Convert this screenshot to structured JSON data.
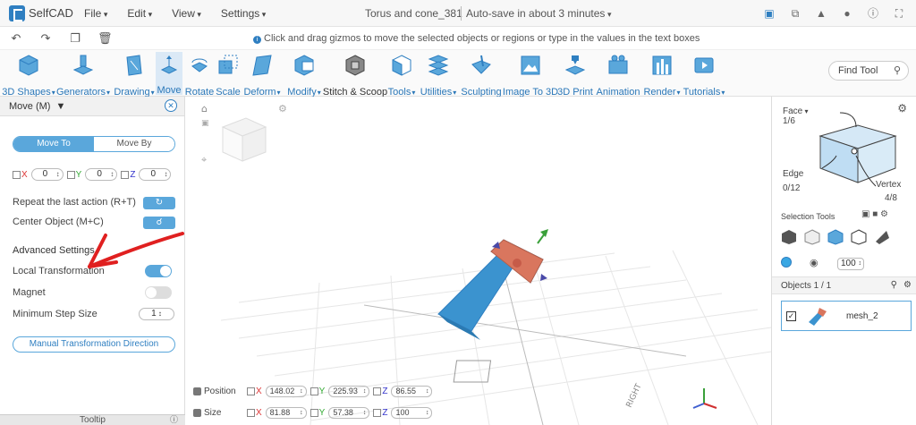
{
  "app": {
    "name": "SelfCAD",
    "menus": [
      "File",
      "Edit",
      "View",
      "Settings"
    ],
    "project_title": "Torus and cone_381",
    "autosave": "Auto-save in about 3 minutes"
  },
  "hint": "Click and drag gizmos to move the selected objects or regions or type in the values in the text boxes",
  "toolbar": {
    "tools": [
      {
        "label": "3D Shapes",
        "icon": "cube-icon",
        "dropdown": true
      },
      {
        "label": "Generators",
        "icon": "generator-icon",
        "dropdown": true
      },
      {
        "label": "Drawing",
        "icon": "drawing-icon",
        "dropdown": true
      },
      {
        "label": "Move",
        "icon": "move-icon",
        "dropdown": false,
        "active": true
      },
      {
        "label": "Rotate",
        "icon": "rotate-icon",
        "dropdown": false
      },
      {
        "label": "Scale",
        "icon": "scale-icon",
        "dropdown": false
      },
      {
        "label": "Deform",
        "icon": "deform-icon",
        "dropdown": true
      },
      {
        "label": "Modify",
        "icon": "modify-icon",
        "dropdown": true
      },
      {
        "label": "Stitch & Scoop",
        "icon": "stitch-scoop-icon",
        "dropdown": false
      },
      {
        "label": "Tools",
        "icon": "tools-icon",
        "dropdown": true
      },
      {
        "label": "Utilities",
        "icon": "utilities-icon",
        "dropdown": true
      },
      {
        "label": "Sculpting",
        "icon": "sculpting-icon",
        "dropdown": false
      },
      {
        "label": "Image To 3D",
        "icon": "image-to-3d-icon",
        "dropdown": false
      },
      {
        "label": "3D Print",
        "icon": "3d-print-icon",
        "dropdown": false
      },
      {
        "label": "Animation",
        "icon": "animation-icon",
        "dropdown": false
      },
      {
        "label": "Render",
        "icon": "render-icon",
        "dropdown": true
      },
      {
        "label": "Tutorials",
        "icon": "tutorials-icon",
        "dropdown": true
      }
    ],
    "find_tool": "Find Tool"
  },
  "left_panel": {
    "title": "Move (M)",
    "segment": {
      "move_to": "Move To",
      "move_by": "Move By"
    },
    "coords": {
      "x": "0",
      "y": "0",
      "z": "0"
    },
    "axis_labels": {
      "x": "X",
      "y": "Y",
      "z": "Z"
    },
    "repeat_label": "Repeat the last action (R+T)",
    "center_label": "Center Object (M+C)",
    "advanced": "Advanced Settings",
    "local_transformation": "Local Transformation",
    "local_transformation_on": true,
    "magnet": "Magnet",
    "magnet_on": false,
    "min_step_label": "Minimum Step Size",
    "min_step_value": "1",
    "manual_direction": "Manual Transformation Direction",
    "tooltip": "Tooltip"
  },
  "viewport": {
    "position_label": "Position",
    "position": {
      "x": "148.02",
      "y": "225.93",
      "z": "86.55"
    },
    "size_label": "Size",
    "size": {
      "x": "81.88",
      "y": "57.38",
      "z": "100"
    },
    "view_cube_label": "RIGHT"
  },
  "right_panel": {
    "face_label": "Face",
    "face_count": "1/6",
    "edge_label": "Edge",
    "edge_count": "0/12",
    "vertex_label": "Vertex",
    "vertex_count": "4/8",
    "selection_tools": "Selection Tools",
    "size_value": "100",
    "objects_header": "Objects 1 / 1",
    "object_name": "mesh_2"
  },
  "colors": {
    "accent": "#2f7fc1",
    "accent_light": "#5aa7db",
    "face_red": "#d9765e",
    "object_blue": "#4aa3d8"
  }
}
